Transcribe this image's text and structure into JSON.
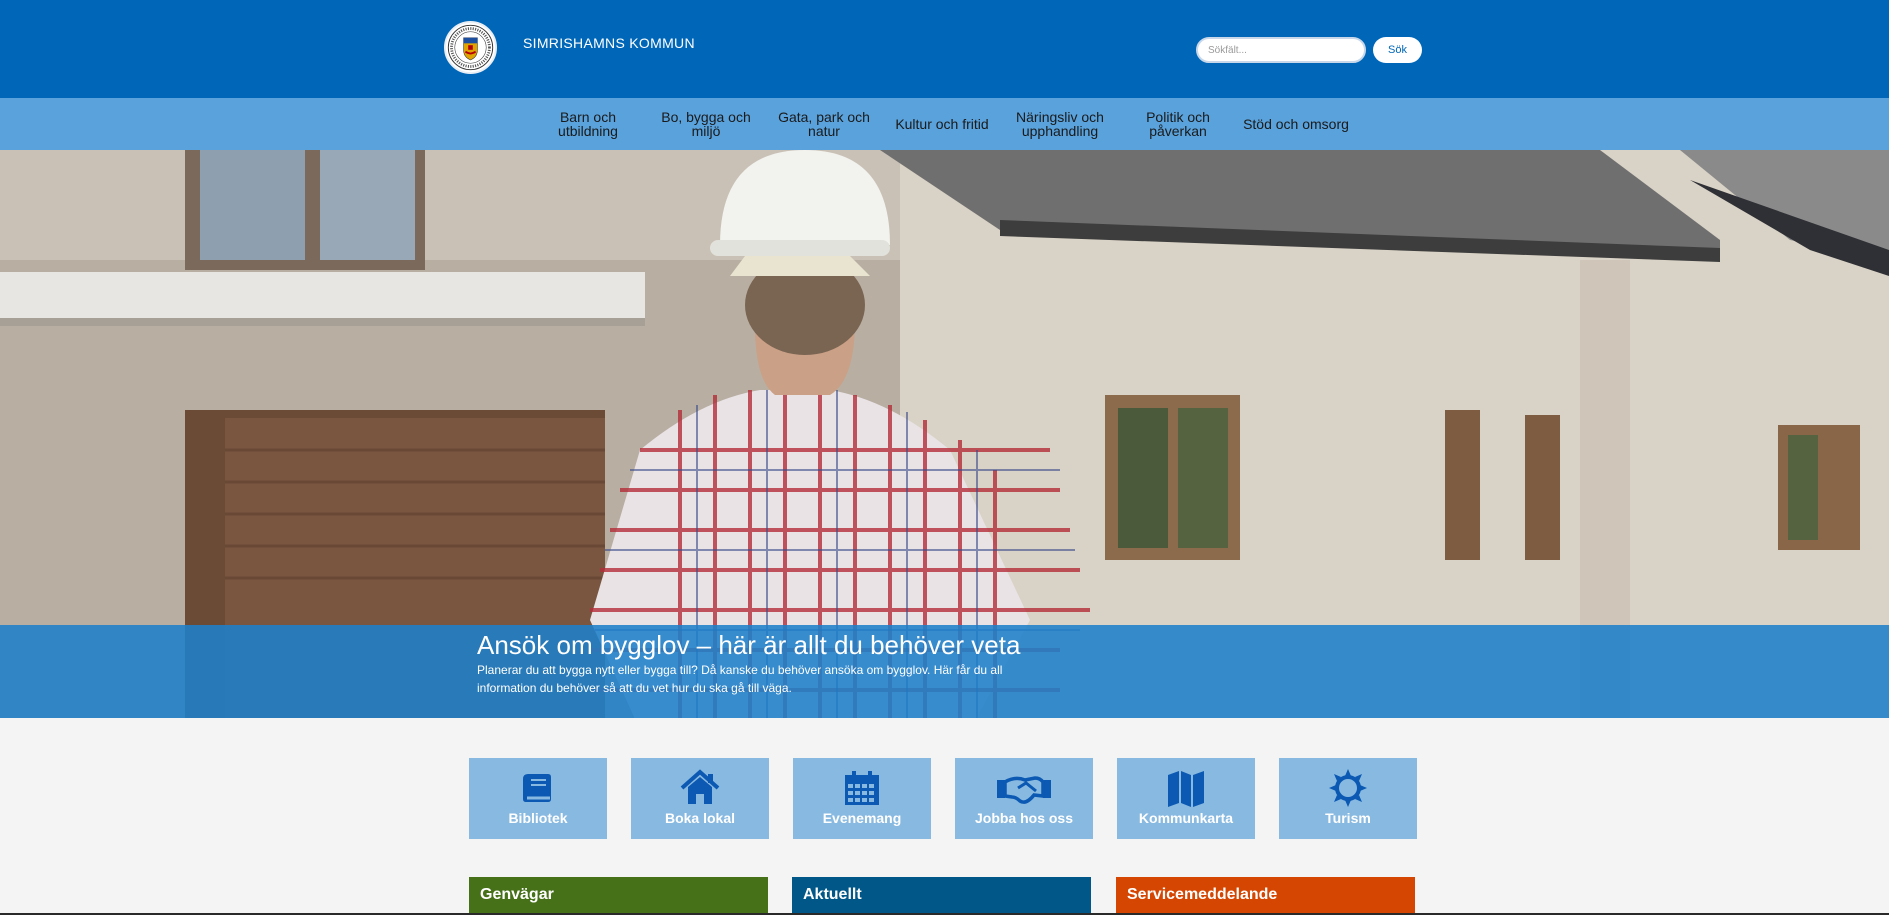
{
  "header": {
    "site_title": "SIMRISHAMNS KOMMUN",
    "search_placeholder": "Sökfält...",
    "search_button": "Sök",
    "colors": {
      "header_bg": "#0067b8",
      "nav_bg": "#5aa2dc"
    }
  },
  "nav": {
    "items": [
      {
        "label": "Barn och utbildning"
      },
      {
        "label": "Bo, bygga och miljö"
      },
      {
        "label": "Gata, park och natur"
      },
      {
        "label": "Kultur och fritid"
      },
      {
        "label": "Näringsliv och upphandling"
      },
      {
        "label": "Politik och påverkan"
      },
      {
        "label": "Stöd och omsorg"
      }
    ]
  },
  "hero": {
    "title": "Ansök om bygglov – här är allt du behöver veta",
    "text": "Planerar du att bygga nytt eller bygga till? Då kanske du behöver ansöka om bygglov. Här får du all information du behöver så att du vet hur du ska gå till väga."
  },
  "tiles": [
    {
      "label": "Bibliotek",
      "icon": "book-icon"
    },
    {
      "label": "Boka lokal",
      "icon": "home-icon"
    },
    {
      "label": "Evenemang",
      "icon": "calendar-icon"
    },
    {
      "label": "Jobba hos oss",
      "icon": "handshake-icon"
    },
    {
      "label": "Kommunkarta",
      "icon": "map-icon"
    },
    {
      "label": "Turism",
      "icon": "sun-icon"
    }
  ],
  "sections": [
    {
      "title": "Genvägar",
      "color": "#467119"
    },
    {
      "title": "Aktuellt",
      "color": "#005788"
    },
    {
      "title": "Servicemeddelande",
      "color": "#d54602"
    }
  ]
}
